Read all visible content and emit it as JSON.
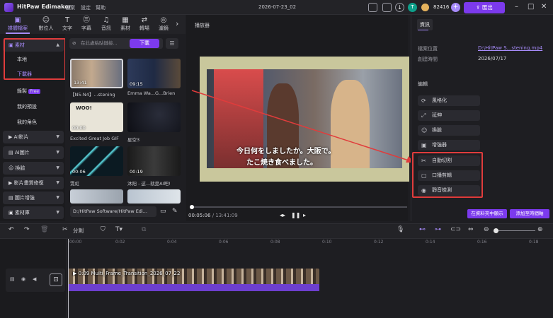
{
  "app": {
    "name": "HitPaw Edimakor",
    "document_title": "2026-07-23_02"
  },
  "menu": [
    "檔案",
    "設定",
    "幫助"
  ],
  "titlebar": {
    "coins": "82416",
    "export_label": "匯出",
    "user_initial": "T"
  },
  "toolbar": [
    {
      "label": "媒體檔案",
      "icon": "folder-icon"
    },
    {
      "label": "數位人",
      "icon": "avatar-icon"
    },
    {
      "label": "文字",
      "icon": "text-icon"
    },
    {
      "label": "字幕",
      "icon": "subtitle-icon"
    },
    {
      "label": "音訊",
      "icon": "music-icon"
    },
    {
      "label": "素材",
      "icon": "sticker-icon"
    },
    {
      "label": "轉場",
      "icon": "transition-icon"
    },
    {
      "label": "濾鏡",
      "icon": "filter-icon"
    }
  ],
  "sidebar": {
    "material": "素材",
    "local": "本地",
    "downloads": "下載器",
    "record": "錄製",
    "record_badge": "Free",
    "presets": "我的預設",
    "roles": "我的角色",
    "ai_video": "AI影片",
    "ai_image": "AI圖片",
    "swap": "換臉",
    "video_repair": "影片畫質修復",
    "image_enhance": "圖片增強",
    "library": "素材庫"
  },
  "media": {
    "search_placeholder": "在此處粘貼鏈接...",
    "download_label": "下載",
    "items": [
      {
        "title": "【N5-N4】...stening",
        "duration": "13:41"
      },
      {
        "title": "Emma Wa...G...Brien",
        "duration": "09:15"
      },
      {
        "title": "Excited Great Job GIF",
        "duration": "00:00",
        "thumb_text": "WOO!"
      },
      {
        "title": "星空3",
        "duration": ""
      },
      {
        "title": "霓虹",
        "duration": "00:06"
      },
      {
        "title": "沐阳 - 这...就是AI吧!",
        "duration": "00:19"
      }
    ],
    "path": "D:/HitPaw Software/HitPaw Edi..."
  },
  "player": {
    "label": "播放器",
    "subtitle_line1": "今日何をしましたか。大阪で。",
    "subtitle_line2": "たこ焼き食べました。",
    "current_time": "00:05:06",
    "total_time": "/ 13:41:09",
    "progress": 0.006
  },
  "info": {
    "tab": "資訊",
    "location_label": "檔案位置",
    "location_value": "D:\\HitPaw S...stening.mp4",
    "created_label": "創建時間",
    "created_value": "2026/07/17",
    "edit_header": "編輯",
    "edit_buttons": [
      "風格化",
      "延伸",
      "換臉",
      "增強器",
      "自動切割",
      "口播剪輯",
      "靜音檢測"
    ],
    "show_in_folder": "在資料夾中顯示",
    "add_to_timeline": "添加至時間軸"
  },
  "timeline": {
    "split_label": "分割",
    "ruler": [
      "00:00",
      "0:02",
      "0:04",
      "0:06",
      "0:08",
      "0:10",
      "0:12",
      "0:14",
      "0:16",
      "0:18"
    ],
    "clip_label": "0:09 Multi_Frame_Transition_2026_07_22"
  },
  "colors": {
    "accent": "#7c3aed",
    "highlight": "#e03c3c",
    "background": "#1e1e22"
  }
}
